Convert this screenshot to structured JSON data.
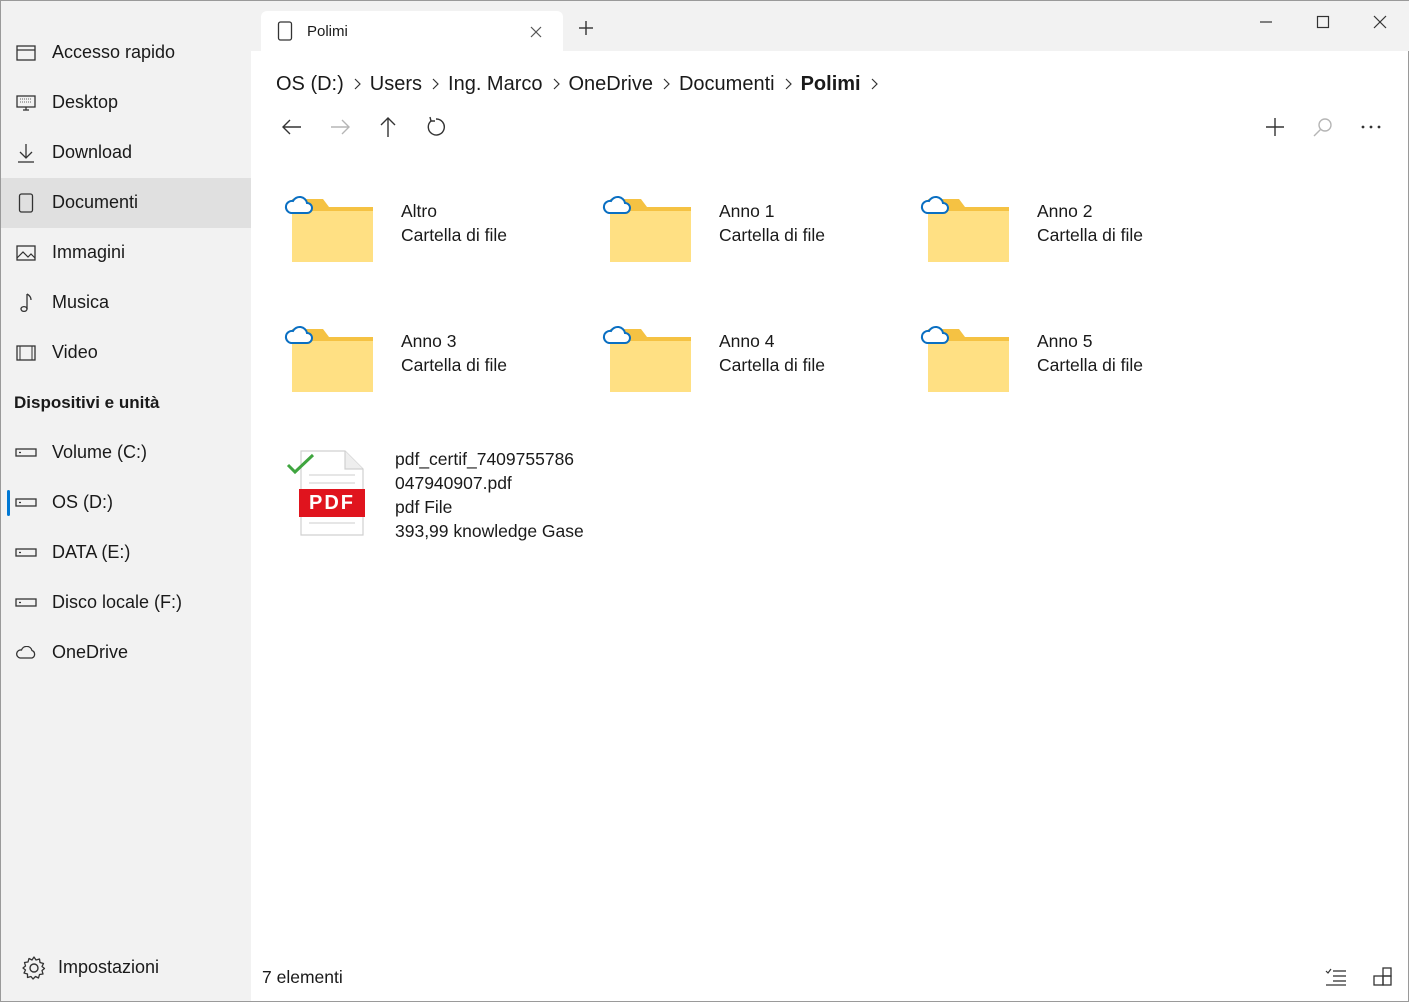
{
  "window": {
    "tab_title": "Polimi",
    "controls": [
      "minimize",
      "maximize",
      "close"
    ]
  },
  "sidebar": {
    "quick_items": [
      {
        "label": "Accesso rapido",
        "icon": "pin-window-icon"
      },
      {
        "label": "Desktop",
        "icon": "desktop-icon"
      },
      {
        "label": "Download",
        "icon": "download-icon"
      },
      {
        "label": "Documenti",
        "icon": "document-icon",
        "selected": true
      },
      {
        "label": "Immagini",
        "icon": "image-icon"
      },
      {
        "label": "Musica",
        "icon": "music-icon"
      },
      {
        "label": "Video",
        "icon": "video-icon"
      }
    ],
    "devices_header": "Dispositivi e unità",
    "device_items": [
      {
        "label": "Volume (C:)",
        "icon": "drive-icon"
      },
      {
        "label": "OS (D:)",
        "icon": "drive-icon",
        "active": true
      },
      {
        "label": "DATA (E:)",
        "icon": "drive-icon"
      },
      {
        "label": "Disco locale (F:)",
        "icon": "drive-icon"
      },
      {
        "label": "OneDrive",
        "icon": "cloud-icon"
      }
    ],
    "settings_label": "Impostazioni"
  },
  "breadcrumb": [
    "OS (D:)",
    "Users",
    "Ing. Marco",
    "OneDrive",
    "Documenti",
    "Polimi"
  ],
  "items": [
    {
      "name": "Altro",
      "kind": "Cartella di file"
    },
    {
      "name": "Anno 1",
      "kind": "Cartella di file"
    },
    {
      "name": "Anno 2",
      "kind": "Cartella di file"
    },
    {
      "name": "Anno 3",
      "kind": "Cartella di file"
    },
    {
      "name": "Anno 4",
      "kind": "Cartella di file"
    },
    {
      "name": "Anno 5",
      "kind": "Cartella di file"
    }
  ],
  "pdf": {
    "name_line1": "pdf_certif_7409755786",
    "name_line2": "047940907.pdf",
    "kind": "pdf File",
    "size": "393,99 knowledge Gase",
    "badge": "PDF"
  },
  "status": {
    "count": "7 elementi"
  },
  "colors": {
    "accent": "#0078d4",
    "folder": "#ffe083",
    "folder_tab": "#f5c243",
    "sync_check": "#3fa53f",
    "pdf_red": "#e0141e"
  }
}
